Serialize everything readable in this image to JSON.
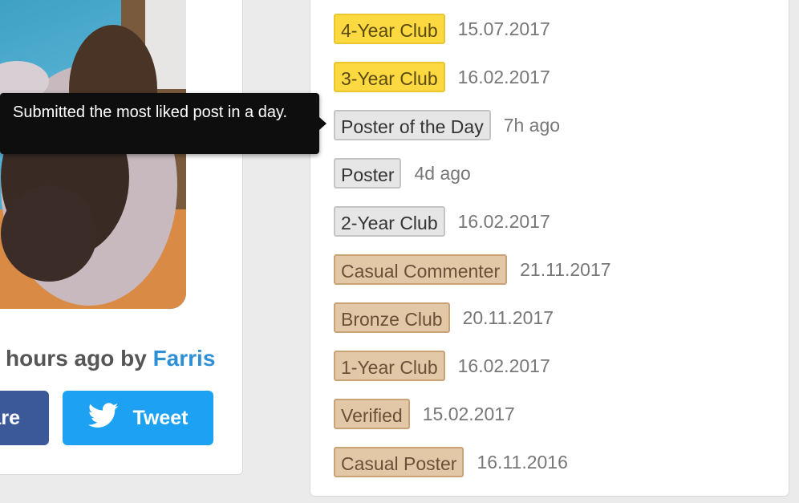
{
  "post": {
    "caption_prefix": "hours ago by",
    "author": "Farris"
  },
  "share": {
    "facebook_label": "are",
    "tweet_label": "Tweet"
  },
  "tooltip": {
    "text": "Submitted the most liked post in a day."
  },
  "badges": [
    {
      "label": "4-Year Club",
      "date": "15.07.2017",
      "tier": "gold"
    },
    {
      "label": "3-Year Club",
      "date": "16.02.2017",
      "tier": "gold"
    },
    {
      "label": "Poster of the Day",
      "date": "7h ago",
      "tier": "silver"
    },
    {
      "label": "Poster",
      "date": "4d ago",
      "tier": "silver"
    },
    {
      "label": "2-Year Club",
      "date": "16.02.2017",
      "tier": "silver"
    },
    {
      "label": "Casual Commenter",
      "date": "21.11.2017",
      "tier": "bronze"
    },
    {
      "label": "Bronze Club",
      "date": "20.11.2017",
      "tier": "bronze"
    },
    {
      "label": "1-Year Club",
      "date": "16.02.2017",
      "tier": "bronze"
    },
    {
      "label": "Verified",
      "date": "15.02.2017",
      "tier": "bronze"
    },
    {
      "label": "Casual Poster",
      "date": "16.11.2016",
      "tier": "bronze"
    }
  ],
  "colors": {
    "author_link": "#2e90d6",
    "facebook": "#3b5998",
    "twitter": "#1da1f2",
    "gold_badge": "#fcd940",
    "silver_badge": "#e6e6e6",
    "bronze_badge": "#e3c8a8"
  },
  "icons": {
    "tweet": "twitter-bird-icon"
  }
}
